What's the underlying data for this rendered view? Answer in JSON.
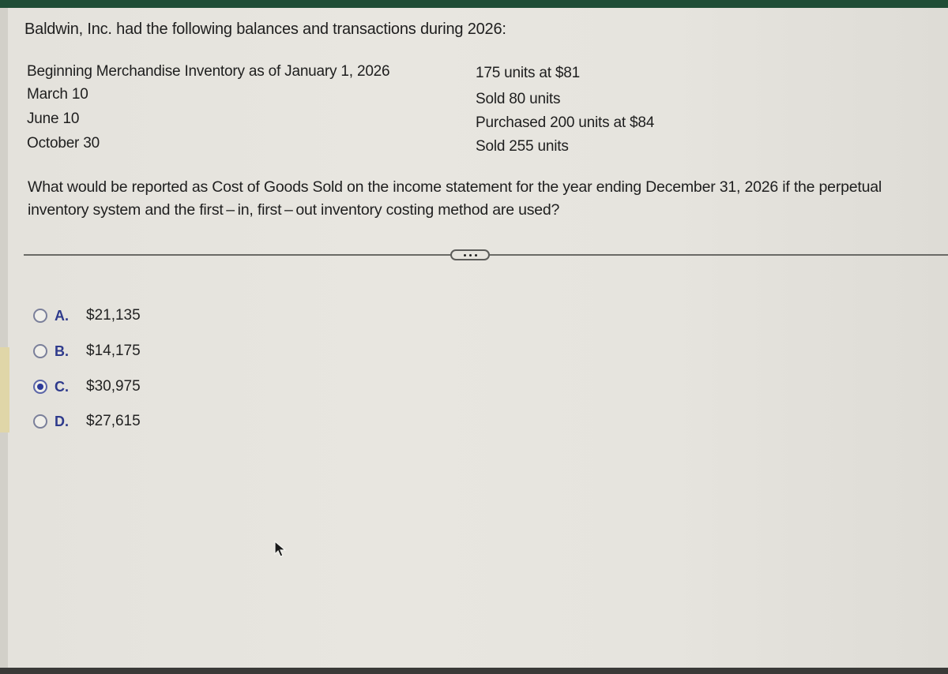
{
  "problem": {
    "intro": "Baldwin, Inc. had the following balances and transactions during 2026:",
    "rows": [
      {
        "label": "Beginning Merchandise Inventory as of January 1, 2026",
        "value": "175 units at $81"
      },
      {
        "label": "March 10",
        "value": "Sold 80 units"
      },
      {
        "label": "June 10",
        "value": "Purchased 200 units at $84"
      },
      {
        "label": "October 30",
        "value": "Sold 255 units"
      }
    ],
    "question": "What would be reported as Cost of Goods Sold on the income statement for the year ending December 31, 2026 if the perpetual inventory system and the first – in, first – out inventory costing method are used?"
  },
  "more_button": {
    "icon": "ellipsis-icon"
  },
  "options": [
    {
      "letter": "A.",
      "value": "$21,135",
      "selected": false
    },
    {
      "letter": "B.",
      "value": "$14,175",
      "selected": false
    },
    {
      "letter": "C.",
      "value": "$30,975",
      "selected": true
    },
    {
      "letter": "D.",
      "value": "$27,615",
      "selected": false
    }
  ]
}
